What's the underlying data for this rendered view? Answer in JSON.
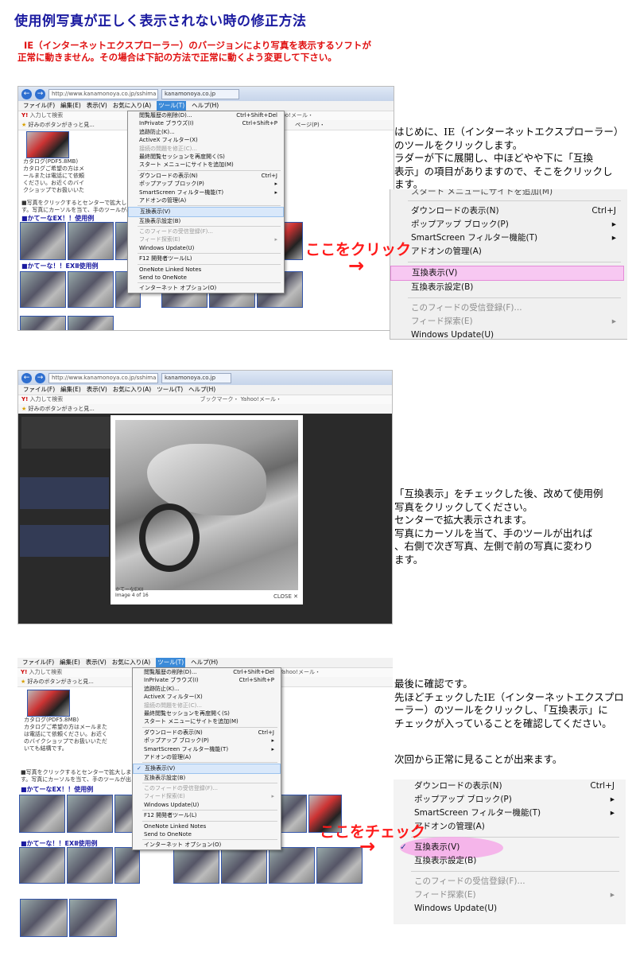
{
  "page": {
    "title": "使用例写真が正しく表示されない時の修正方法",
    "intro_lines": [
      "IE（インターネットエクスプローラー）のバージョンにより写真を表示するソフトが",
      "正常に動きません。その場合は下記の方法で正常に動くよう変更して下さい。"
    ]
  },
  "ie": {
    "url": "http://www.kanamonoya.co.jp/sshima",
    "tab": "kanamonoya.co.jp",
    "menubar": [
      "ファイル(F)",
      "編集(E)",
      "表示(V)",
      "お気に入り(A)",
      "ツール(T)",
      "ヘルプ(H)"
    ],
    "search_placeholder": "入力して検索",
    "favorites_bar": "好みのボタンがきっと見...",
    "toolbar_right": "ブックマーク・ Yahoo!メール・",
    "toolbar_page": "ページ(P)・",
    "tools_menu": [
      {
        "label": "閲覧履歴の削除(D)...",
        "shortcut": "Ctrl+Shift+Del"
      },
      {
        "label": "InPrivate ブラウズ(I)",
        "shortcut": "Ctrl+Shift+P"
      },
      {
        "label": "追跡防止(K)...",
        "shortcut": ""
      },
      {
        "label": "ActiveX フィルター(X)",
        "shortcut": ""
      },
      {
        "label": "接続の問題を修正(C)...",
        "shortcut": ""
      },
      {
        "label": "最終閲覧セッションを再度開く(S)",
        "shortcut": ""
      },
      {
        "label": "スタート メニューにサイトを追加(M)",
        "shortcut": ""
      },
      {
        "label": "ダウンロードの表示(N)",
        "shortcut": "Ctrl+J"
      },
      {
        "label": "ポップアップ ブロック(P)",
        "shortcut": "▸"
      },
      {
        "label": "SmartScreen フィルター機能(T)",
        "shortcut": "▸"
      },
      {
        "label": "アドオンの管理(A)",
        "shortcut": ""
      },
      {
        "label": "互換表示(V)",
        "shortcut": ""
      },
      {
        "label": "互換表示設定(B)",
        "shortcut": ""
      },
      {
        "label": "このフィードの受信登録(F)...",
        "shortcut": ""
      },
      {
        "label": "フィード探索(E)",
        "shortcut": "▸"
      },
      {
        "label": "Windows Update(U)",
        "shortcut": ""
      },
      {
        "label": "F12 開発者ツール(L)",
        "shortcut": ""
      },
      {
        "label": "OneNote Linked Notes",
        "shortcut": ""
      },
      {
        "label": "Send to OneNote",
        "shortcut": ""
      },
      {
        "label": "インターネット オプション(O)",
        "shortcut": ""
      }
    ],
    "page_texts": {
      "catalog": "カタログ(PDF5.8MB)",
      "catalog_note": "カタログご希望の方はメールまたは電話にて依頼ください。お近くのバイクショップでお扱いいただいても結構です。",
      "click_note": "■写真をクリックするとセンターで拡大します。写真にカーソルを当て、手のツールが出れば右側で",
      "section1": "■かてーなEX！！使用例",
      "section2": "■かてーな！！EXⅡ使用例"
    }
  },
  "zoom_menu": {
    "items": [
      {
        "label": "ダウンロードの表示(N)",
        "shortcut": "Ctrl+J"
      },
      {
        "label": "ポップアップ ブロック(P)",
        "shortcut": "▸"
      },
      {
        "label": "SmartScreen フィルター機能(T)",
        "shortcut": "▸"
      },
      {
        "label": "アドオンの管理(A)",
        "shortcut": ""
      },
      {
        "label": "互換表示(V)",
        "shortcut": ""
      },
      {
        "label": "互換表示設定(B)",
        "shortcut": ""
      },
      {
        "label": "このフィードの受信登録(F)...",
        "shortcut": ""
      },
      {
        "label": "フィード探索(E)",
        "shortcut": "▸"
      },
      {
        "label": "Windows Update(U)",
        "shortcut": ""
      }
    ],
    "cut_top": "スタート メニューにサイトを追加(M)"
  },
  "callouts": {
    "click": "ここをクリック",
    "check": "ここをチェック",
    "arrow": "→"
  },
  "step1": [
    "はじめに、IE（インターネットエクスプローラー）",
    "のツールをクリックします。",
    "ラダーが下に展開し、中ほどやや下に「互換",
    "表示」の項目がありますので、そこをクリックし",
    "ます。"
  ],
  "step2": [
    "「互換表示」をチェックした後、改めて使用例",
    "写真をクリックしてください。",
    "センターで拡大表示されます。",
    "写真にカーソルを当て、手のツールが出れば",
    "、右側で次ぎ写真、左側で前の写真に変わり",
    "ます。"
  ],
  "step3": [
    "最後に確認です。",
    "先ほどチェックしたIE（インターネットエクスプロ",
    "ーラー）のツールをクリックし、「互換表示」に",
    "チェックが入っていることを確認してください。"
  ],
  "step3_final": "次回から正常に見ることが出来ます。",
  "lightbox": {
    "caption": "かてーなEXII",
    "caption2": "Image 4 of 16",
    "close": "CLOSE"
  },
  "colors": {
    "title": "#1a1aa0",
    "intro": "#e01010",
    "callout": "#ff1a1a",
    "highlight_pink": "#f5a9e8"
  }
}
